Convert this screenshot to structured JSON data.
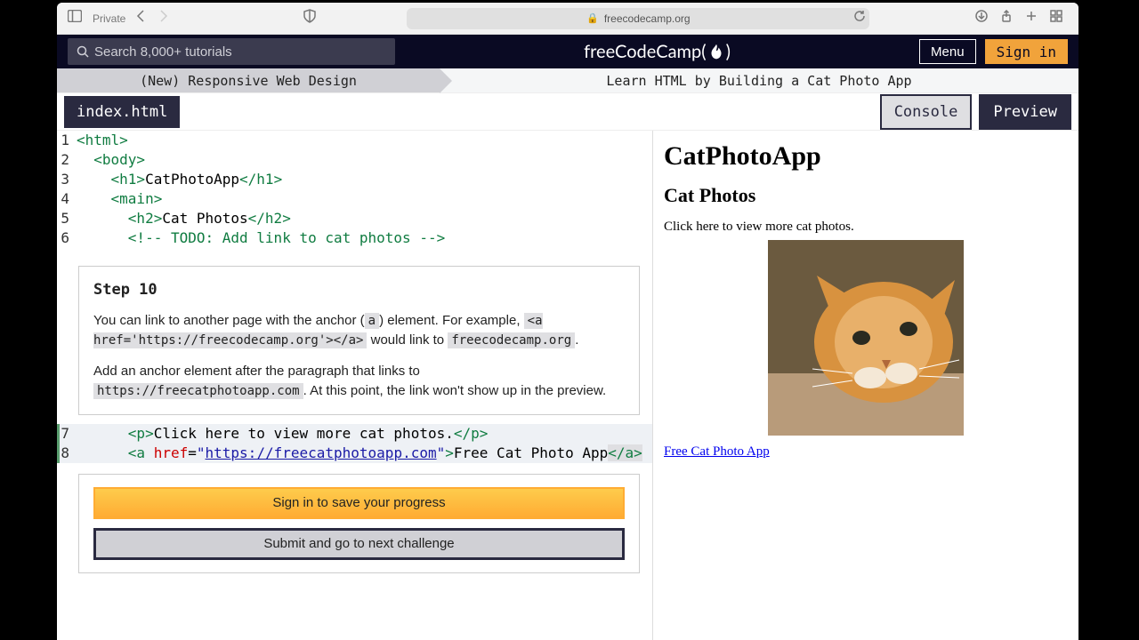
{
  "browser": {
    "private_label": "Private",
    "url_domain": "freecodecamp.org"
  },
  "header": {
    "search_placeholder": "Search 8,000+ tutorials",
    "logo_text": "freeCodeCamp",
    "menu_label": "Menu",
    "signin_label": "Sign in"
  },
  "breadcrumb": {
    "course": "(New) Responsive Web Design",
    "challenge": "Learn HTML by Building a Cat Photo App"
  },
  "tabs": {
    "file": "index.html",
    "console": "Console",
    "preview": "Preview"
  },
  "code": {
    "l1": "<html>",
    "l2": "  <body>",
    "l3a": "    <h1>",
    "l3b": "CatPhotoApp",
    "l3c": "</h1>",
    "l4": "    <main>",
    "l5a": "      <h2>",
    "l5b": "Cat Photos",
    "l5c": "</h2>",
    "l6": "      <!-- TODO: Add link to cat photos -->",
    "l7a": "      <p>",
    "l7b": "Click here to view more cat photos.",
    "l7c": "</p>",
    "l8a": "      <a ",
    "l8attr": "href",
    "l8eq": "=",
    "l8q": "\"",
    "l8url": "https://freecatphotoapp.com",
    "l8b": ">",
    "l8txt": "Free Cat Photo App",
    "l8c": "</a>"
  },
  "gutters": {
    "g1": "1",
    "g2": "2",
    "g3": "3",
    "g4": "4",
    "g5": "5",
    "g6": "6",
    "g7": "7",
    "g8": "8"
  },
  "step": {
    "title": "Step 10",
    "p1a": "You can link to another page with the anchor (",
    "p1_code1": "a",
    "p1b": ") element. For example, ",
    "p1_code2": "<a href='https://freecodecamp.org'></a>",
    "p1c": " would link to ",
    "p1_code3": "freecodecamp.org",
    "p1d": ".",
    "p2a": "Add an anchor element after the paragraph that links to ",
    "p2_code1": "https://freecatphotoapp.com",
    "p2b": ". At this point, the link won't show up in the preview."
  },
  "actions": {
    "signin": "Sign in to save your progress",
    "submit": "Submit and go to next challenge"
  },
  "preview": {
    "h1": "CatPhotoApp",
    "h2": "Cat Photos",
    "p": "Click here to view more cat photos.",
    "link": "Free Cat Photo App"
  }
}
